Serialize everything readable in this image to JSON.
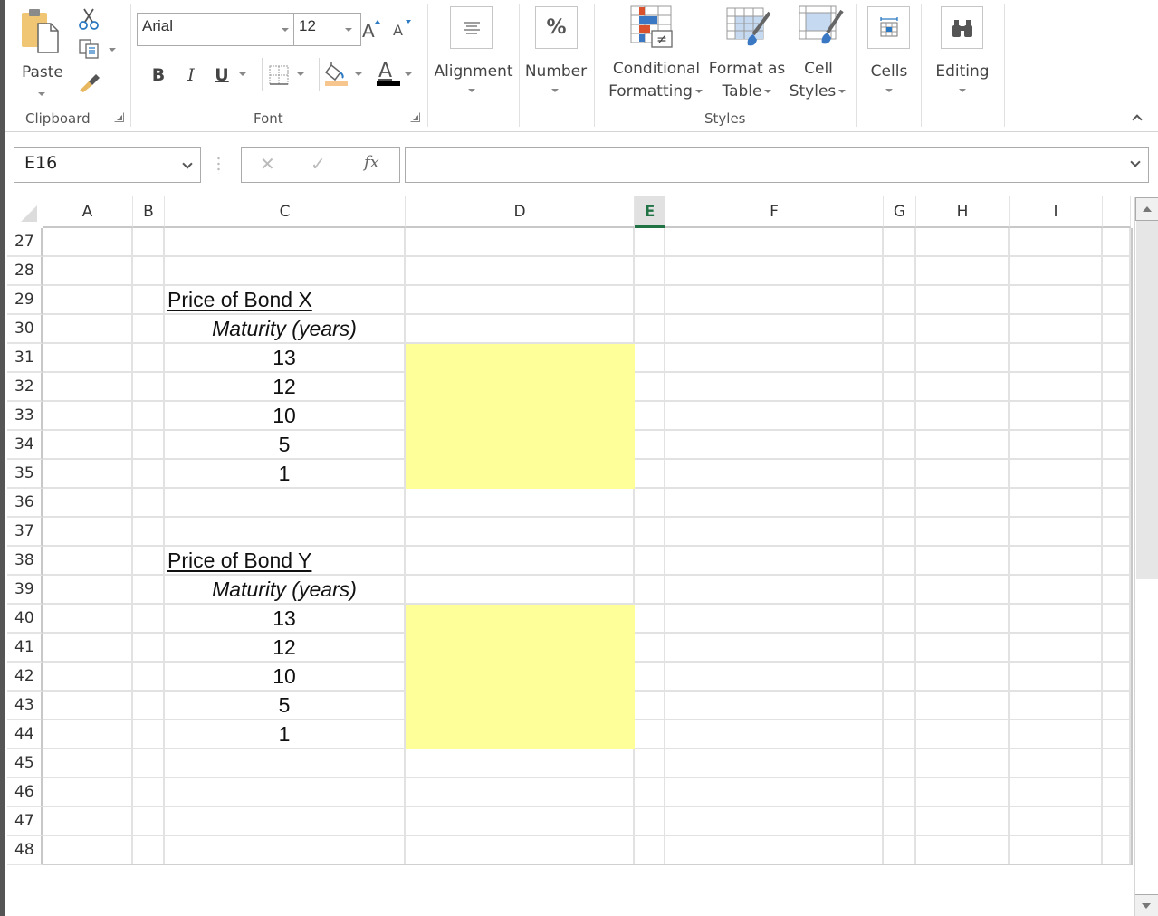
{
  "ribbon": {
    "clipboard": {
      "group_label": "Clipboard",
      "paste_label": "Paste",
      "icons": [
        "paste-icon",
        "cut-icon",
        "copy-icon",
        "format-painter-icon"
      ]
    },
    "font": {
      "group_label": "Font",
      "font_name": "Arial",
      "font_size": "12",
      "bold": "B",
      "italic": "I",
      "underline": "U",
      "font_color": "#000000",
      "fill_color": "#f7c68f",
      "grow_label": "A",
      "shrink_label": "A",
      "font_color_label": "A"
    },
    "alignment": {
      "label": "Alignment"
    },
    "number": {
      "label": "Number",
      "icon_glyph": "%"
    },
    "styles": {
      "group_label": "Styles",
      "conditional_formatting": [
        "Conditional",
        "Formatting"
      ],
      "format_as_table": [
        "Format as",
        "Table"
      ],
      "cell_styles": [
        "Cell",
        "Styles"
      ]
    },
    "cells": {
      "label": "Cells"
    },
    "editing": {
      "label": "Editing"
    }
  },
  "formula_bar": {
    "name_box": "E16",
    "cancel_glyph": "✕",
    "enter_glyph": "✓",
    "fx_glyph": "fx",
    "formula": ""
  },
  "sheet": {
    "active_column": "E",
    "columns": [
      "A",
      "B",
      "C",
      "D",
      "E",
      "F",
      "G",
      "H",
      "I"
    ],
    "rows": [
      27,
      28,
      29,
      30,
      31,
      32,
      33,
      34,
      35,
      36,
      37,
      38,
      39,
      40,
      41,
      42,
      43,
      44,
      45,
      46,
      47,
      48
    ],
    "highlight_color": "#ffff99",
    "bond_x": {
      "title": "Price of Bond X",
      "subtitle": "Maturity (years)",
      "maturities": [
        "13",
        "12",
        "10",
        "5",
        "1"
      ]
    },
    "bond_y": {
      "title": "Price of Bond Y",
      "subtitle": "Maturity (years)",
      "maturities": [
        "13",
        "12",
        "10",
        "5",
        "1"
      ]
    }
  }
}
